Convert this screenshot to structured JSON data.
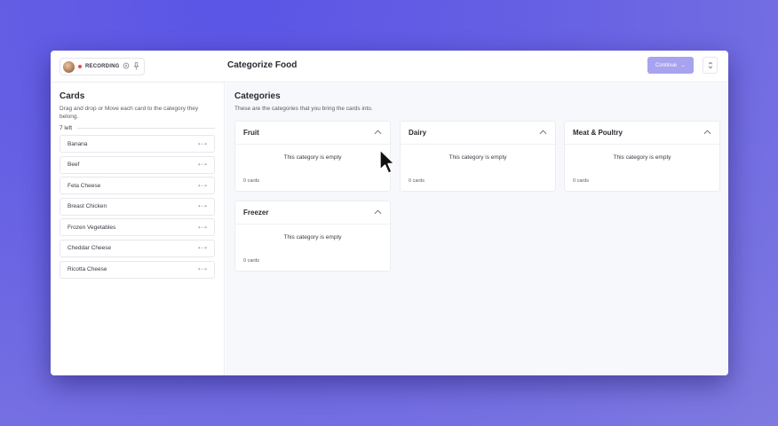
{
  "topbar": {
    "recording_label": "RECORDING",
    "title": "Categorize Food",
    "continue_label": "Continue",
    "continue_arrow": "→"
  },
  "sidebar": {
    "title": "Cards",
    "description": "Drag and drop or Move each card to the category they belong.",
    "left_count": "7 left",
    "cards": [
      {
        "label": "Banana"
      },
      {
        "label": "Beef"
      },
      {
        "label": "Feta Cheese"
      },
      {
        "label": "Breast Chicken"
      },
      {
        "label": "Frozen Vegetables"
      },
      {
        "label": "Cheddar Cheese"
      },
      {
        "label": "Ricotta Cheese"
      }
    ]
  },
  "main": {
    "title": "Categories",
    "description": "These are the categories that you bring the cards into.",
    "categories": [
      {
        "name": "Fruit",
        "empty_text": "This category is empty",
        "count": "0 cards"
      },
      {
        "name": "Dairy",
        "empty_text": "This category is empty",
        "count": "0 cards"
      },
      {
        "name": "Meat & Poultry",
        "empty_text": "This category is empty",
        "count": "0 cards"
      },
      {
        "name": "Freezer",
        "empty_text": "This category is empty",
        "count": "0 cards"
      }
    ]
  },
  "icons": {
    "move": "move-icon",
    "collapse": "chevron-up-icon",
    "settings": "settings-icon",
    "mic": "microphone-icon"
  },
  "colors": {
    "accent": "#a7a3ee",
    "recording": "#ef4444",
    "background": "#6660e4"
  }
}
